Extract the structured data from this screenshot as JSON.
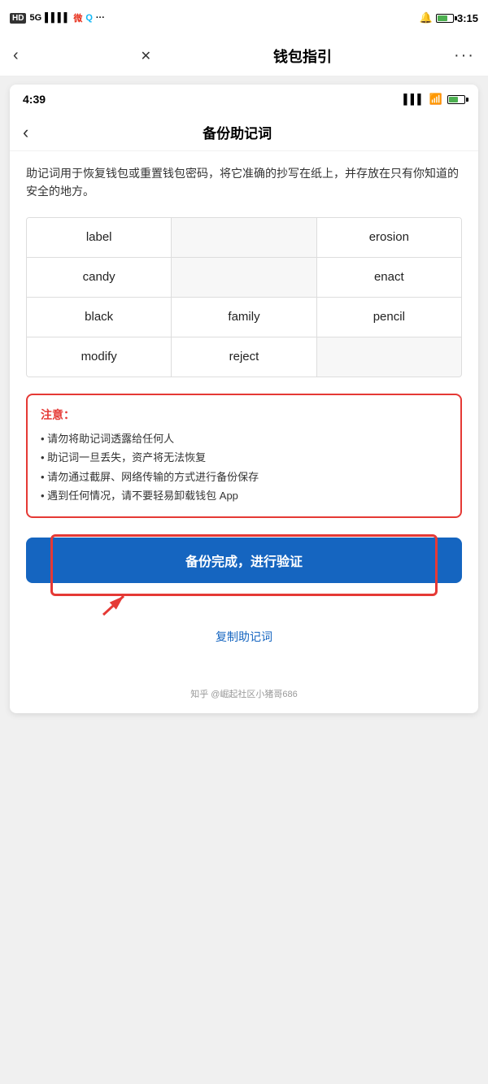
{
  "outer_status": {
    "left_icons": "HD 5G",
    "time": "3:15",
    "bell_icon": "🔔",
    "battery_label": "battery"
  },
  "outer_nav": {
    "back_label": "‹",
    "close_label": "✕",
    "title": "钱包指引",
    "dots_label": "···"
  },
  "inner_status": {
    "time": "4:39"
  },
  "inner_nav": {
    "back_label": "‹",
    "title": "备份助记词"
  },
  "content": {
    "description": "助记词用于恢复钱包或重置钱包密码，将它准确的抄写在纸上，并存放在只有你知道的安全的地方。",
    "words": [
      [
        "label",
        "",
        "erosion"
      ],
      [
        "candy",
        "",
        "enact"
      ],
      [
        "black",
        "family",
        "pencil"
      ],
      [
        "modify",
        "reject",
        ""
      ]
    ],
    "warning": {
      "title": "注意：",
      "items": [
        "• 请勿将助记词透露给任何人",
        "• 助记词一旦丢失，资产将无法恢复",
        "• 请勿通过截屏、网络传输的方式进行备份保存",
        "• 遇到任何情况，请不要轻易卸载钱包 App"
      ]
    },
    "verify_button": "备份完成，进行验证",
    "copy_link": "复制助记词"
  },
  "footer": {
    "watermark": "知乎 @崛起社区小猪哥686"
  }
}
